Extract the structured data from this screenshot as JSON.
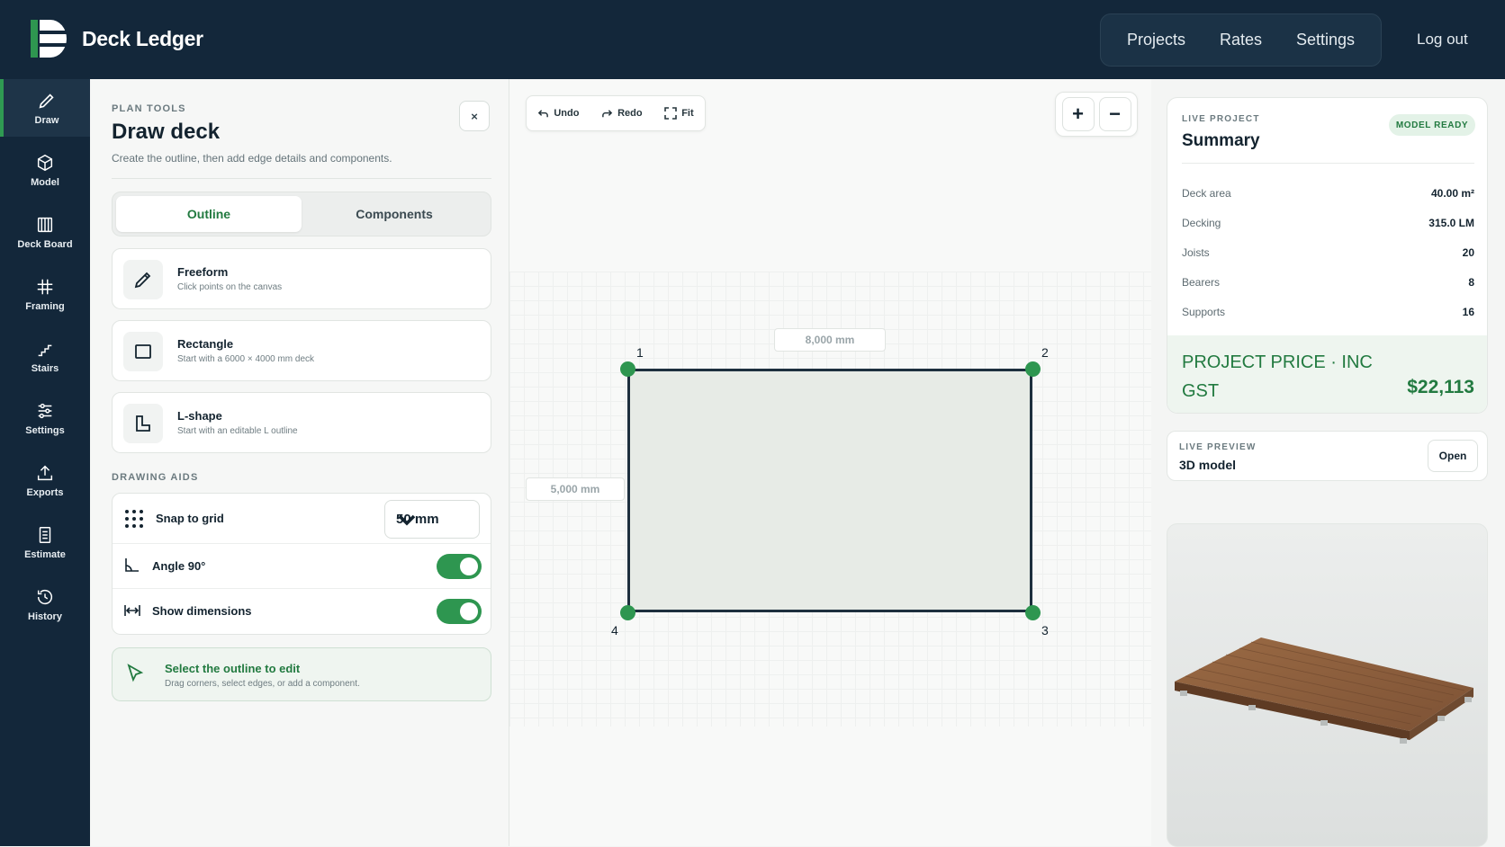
{
  "header": {
    "brand": "Deck Ledger",
    "nav": [
      "Projects",
      "Rates",
      "Settings"
    ],
    "logout": "Log out"
  },
  "sidebar": {
    "items": [
      {
        "label": "Draw",
        "icon": "pencil-icon"
      },
      {
        "label": "Model",
        "icon": "cube-icon"
      },
      {
        "label": "Deck Board",
        "icon": "boards-icon"
      },
      {
        "label": "Framing",
        "icon": "hash-icon"
      },
      {
        "label": "Stairs",
        "icon": "stairs-icon"
      },
      {
        "label": "Settings",
        "icon": "sliders-icon"
      },
      {
        "label": "Exports",
        "icon": "upload-icon"
      },
      {
        "label": "Estimate",
        "icon": "document-icon"
      },
      {
        "label": "History",
        "icon": "history-icon"
      }
    ]
  },
  "panel": {
    "eyebrow": "PLAN TOOLS",
    "title": "Draw deck",
    "subtitle": "Create the outline, then add edge details and components.",
    "close": "×",
    "tabs": [
      "Outline",
      "Components"
    ],
    "tools": [
      {
        "title": "Freeform",
        "desc": "Click points on the canvas"
      },
      {
        "title": "Rectangle",
        "desc": "Start with a 6000 × 4000 mm deck"
      },
      {
        "title": "L-shape",
        "desc": "Start with an editable L outline"
      }
    ],
    "aids_label": "DRAWING AIDS",
    "snap": {
      "label": "Snap to grid",
      "value": "50 mm"
    },
    "angle": {
      "label": "Angle 90°",
      "on": true
    },
    "dims": {
      "label": "Show dimensions",
      "on": true
    },
    "hint": {
      "title": "Select the outline to edit",
      "desc": "Drag corners, select edges, or add a component."
    }
  },
  "canvas": {
    "undo": "Undo",
    "redo": "Redo",
    "fit": "Fit",
    "zoom_in": "+",
    "zoom_out": "−",
    "width_label": "8,000 mm",
    "height_label": "5,000 mm",
    "points": [
      "1",
      "2",
      "3",
      "4"
    ]
  },
  "summary": {
    "eyebrow": "LIVE PROJECT",
    "title": "Summary",
    "badge": "MODEL READY",
    "rows": [
      {
        "k": "Deck area",
        "v": "40.00 m²"
      },
      {
        "k": "Decking",
        "v": "315.0 LM"
      },
      {
        "k": "Joists",
        "v": "20"
      },
      {
        "k": "Bearers",
        "v": "8"
      },
      {
        "k": "Supports",
        "v": "16"
      }
    ],
    "price_label": "PROJECT PRICE · INC GST",
    "price": "$22,113"
  },
  "preview": {
    "eyebrow": "LIVE PREVIEW",
    "title": "3D model",
    "open": "Open"
  },
  "colors": {
    "navy": "#13273a",
    "green": "#2e9650",
    "accent_text": "#227a40"
  }
}
